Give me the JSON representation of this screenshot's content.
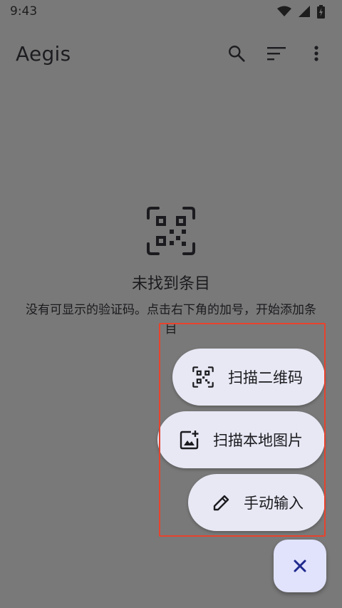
{
  "status_bar": {
    "time": "9:43"
  },
  "app_bar": {
    "title": "Aegis",
    "actions": [
      "search-icon",
      "sort-icon",
      "more-vert-icon"
    ]
  },
  "empty_state": {
    "icon": "qr-code-scan-icon",
    "title": "未找到条目",
    "description": "没有可显示的验证码。点击右下角的加号，开始添加条目"
  },
  "fab_menu": {
    "items": [
      {
        "label": "扫描二维码",
        "icon": "qr-code-scan-icon"
      },
      {
        "label": "扫描本地图片",
        "icon": "add-photo-icon"
      },
      {
        "label": "手动输入",
        "icon": "pencil-icon"
      }
    ],
    "close_icon": "close-icon"
  },
  "colors": {
    "scrim_background": "#797979",
    "fab_option_bg": "#e7e8f4",
    "fab_close_bg": "#e1e3fd",
    "highlight": "#e8422d",
    "close_icon": "#1f2a8c"
  }
}
